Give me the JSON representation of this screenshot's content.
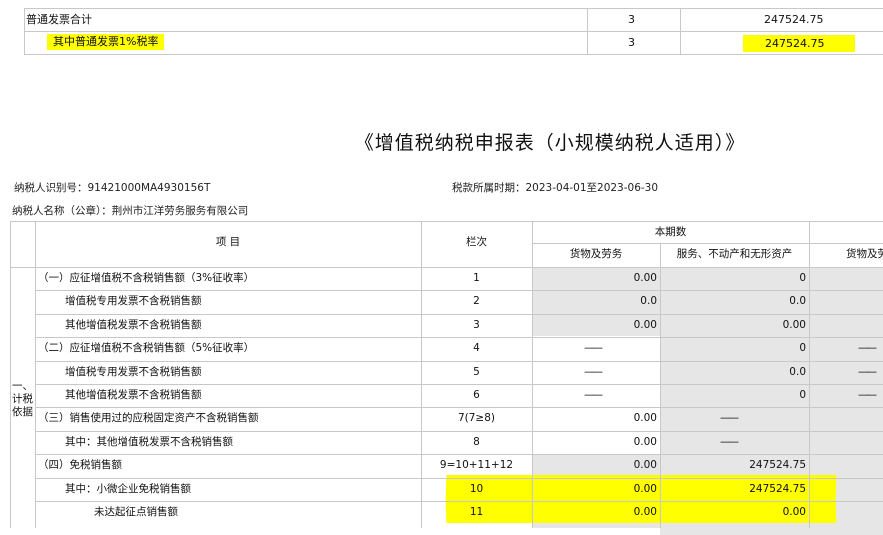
{
  "top_table": {
    "rows": [
      {
        "label": "普通发票合计",
        "column": "3",
        "amount": "247524.75"
      },
      {
        "label": "其中普通发票1%税率",
        "column": "3",
        "amount": "247524.75"
      }
    ]
  },
  "form": {
    "title": "《增值税纳税申报表（小规模纳税人适用）》",
    "taxpayer_id": "纳税人识别号：91421000MA4930156T",
    "period": "税款所属时期：2023-04-01至2023-06-30",
    "taxpayer_name": "纳税人名称（公章）：荆州市江洋劳务服务有限公司",
    "headers": {
      "item": "项 目",
      "column_no": "栏次",
      "current_period": "本期数",
      "goods": "货物及劳务",
      "services": "服务、不动产和无形资产",
      "goods_partial": "货物及劳"
    },
    "section_label": [
      "一、",
      "计税",
      "依据"
    ],
    "dash": "——",
    "rows": [
      {
        "item": "（一）应征增值税不含税销售额（3%征收率）",
        "col": "1",
        "goods": "0.00",
        "services": "0"
      },
      {
        "item": "增值税专用发票不含税销售额",
        "col": "2",
        "goods": "0.0",
        "services": "0.0"
      },
      {
        "item": "其他增值税发票不含税销售额",
        "col": "3",
        "goods": "0.00",
        "services": "0.00"
      },
      {
        "item": "（二）应征增值税不含税销售额（5%征收率）",
        "col": "4",
        "goods": "——",
        "services": "0"
      },
      {
        "item": "增值税专用发票不含税销售额",
        "col": "5",
        "goods": "——",
        "services": "0.0"
      },
      {
        "item": "其他增值税发票不含税销售额",
        "col": "6",
        "goods": "——",
        "services": "0"
      },
      {
        "item": "（三）销售使用过的应税固定资产不含税销售额",
        "col": "7(7≥8)",
        "goods": "0.00",
        "services": "——"
      },
      {
        "item": "其中：其他增值税发票不含税销售额",
        "col": "8",
        "goods": "0.00",
        "services": "——"
      },
      {
        "item": "（四）免税销售额",
        "col": "9=10+11+12",
        "goods": "0.00",
        "services": "247524.75"
      },
      {
        "item": "其中：小微企业免税销售额",
        "col": "10",
        "goods": "0.00",
        "services": "247524.75"
      },
      {
        "item": "未达起征点销售额",
        "col": "11",
        "goods": "0.00",
        "services": "0.00"
      }
    ]
  },
  "colors": {
    "highlight": "#ffff00",
    "grid": "#c8c8c8",
    "shade": "#e6e6e6"
  }
}
